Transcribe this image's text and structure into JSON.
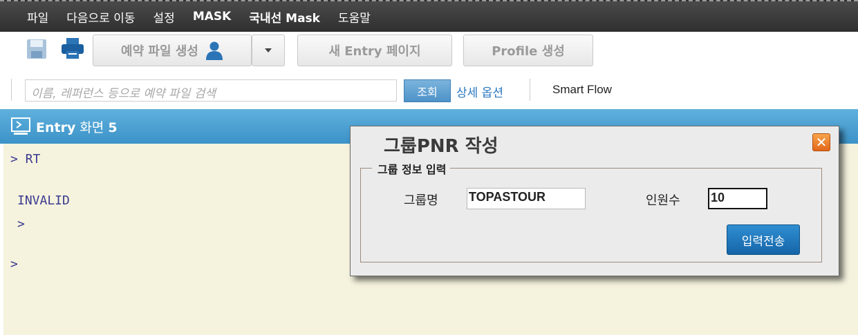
{
  "menu": {
    "items": [
      "파일",
      "다음으로 이동",
      "설정",
      "MASK",
      "국내선 Mask",
      "도움말"
    ]
  },
  "toolbar": {
    "save_icon": "save-icon",
    "print_icon": "print-icon",
    "new_pnr_label": "예약 파일 생성",
    "new_entry_label": "새 Entry 페이지",
    "profile_label": "Profile 생성"
  },
  "search": {
    "placeholder": "이름, 레퍼런스 등으로 예약 파일 검색",
    "button_label": "조회",
    "advanced_label": "상세 옵션",
    "smart_flow_label": "Smart Flow"
  },
  "entry": {
    "title_bold": "Entry",
    "title_mid": " 화면 ",
    "title_num": "5"
  },
  "terminal": {
    "lines": [
      "> RT",
      "INVALID",
      ">",
      ">"
    ]
  },
  "dialog": {
    "title": "그룹PNR 작성",
    "group_legend": "그룹 정보 입력",
    "group_name_label": "그룹명",
    "group_name_value": "TOPASTOUR",
    "count_label": "인원수",
    "count_value": "10",
    "submit_label": "입력전송"
  },
  "colors": {
    "menubar": "#3c3c3c",
    "entrybar": "#4aa2d4",
    "terminal_bg": "#f5f3de",
    "terminal_text": "#3b3a8f",
    "submit": "#1f7bc0"
  }
}
